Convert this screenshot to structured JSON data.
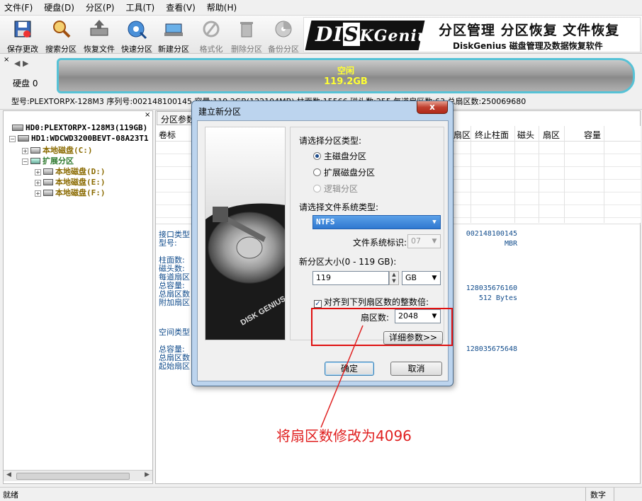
{
  "menu": [
    "文件(F)",
    "硬盘(D)",
    "分区(P)",
    "工具(T)",
    "查看(V)",
    "帮助(H)"
  ],
  "toolbar": {
    "save": "保存更改",
    "search": "搜索分区",
    "recover": "恢复文件",
    "quick": "快速分区",
    "new": "新建分区",
    "format": "格式化",
    "delete": "删除分区",
    "backup": "备份分区"
  },
  "banner": {
    "logo_a": "DI",
    "logo_b": "S",
    "logo_c": "KGenius",
    "line1": "分区管理 分区恢复 文件恢复",
    "line2": "DiskGenius 磁盘管理及数据恢复软件"
  },
  "diskstrip": {
    "close": "×",
    "nav": "◀ ▶",
    "disk_label": "硬盘 0",
    "bar_l1": "空闲",
    "bar_l2": "119.2GB"
  },
  "diskinfo": "型号:PLEXTORPX-128M3  序列号:002148100145  容量:119.2GB(122104MB)  柱面数:15566  磁头数:255  每道扇区数:63  总扇区数:250069680",
  "tree": {
    "close": "×",
    "items": [
      "HD0:PLEXTORPX-128M3(119GB)",
      "HD1:WDCWD3200BEVT-08A23T1",
      "本地磁盘(C:)",
      "扩展分区",
      "本地磁盘(D:)",
      "本地磁盘(E:)",
      "本地磁盘(F:)"
    ]
  },
  "right": {
    "tab": "分区参数",
    "col_label": "卷标",
    "cols": [
      "扇区",
      "终止柱面",
      "磁头",
      "扇区",
      "容量"
    ],
    "props1": [
      "接口类型",
      "型号:"
    ],
    "props2": [
      "柱面数:",
      "磁头数:",
      "每道扇区",
      "总容量:",
      "总扇区数",
      "附加扇区"
    ],
    "props3": "空间类型",
    "props4": [
      "总容量:",
      "总扇区数",
      "起始扇区"
    ],
    "val1": "002148100145",
    "val2": "MBR",
    "val3": "128035676160",
    "val4": "512 Bytes",
    "val5": "128035675648"
  },
  "dialog": {
    "title": "建立新分区",
    "close": "x",
    "img_text": "DISK GENIUS",
    "type_label": "请选择分区类型:",
    "radio_primary": "主磁盘分区",
    "radio_extended": "扩展磁盘分区",
    "radio_logical": "逻辑分区",
    "fs_label": "请选择文件系统类型:",
    "fs_value": "NTFS",
    "fsid_label": "文件系统标识:",
    "fsid_value": "07",
    "size_label": "新分区大小(0 - 119 GB):",
    "size_value": "119",
    "size_unit": "GB",
    "align_label": "对齐到下列扇区数的整数倍:",
    "sector_label": "扇区数:",
    "sector_value": "2048",
    "detail_button": "详细参数>>",
    "ok": "确定",
    "cancel": "取消"
  },
  "annotation": "将扇区数修改为4096",
  "status": {
    "left": "就绪",
    "num": "数字"
  },
  "colors": {
    "accent_red": "#e02020",
    "disk_border": "#56c2d6",
    "free_text": "#ffff33"
  }
}
